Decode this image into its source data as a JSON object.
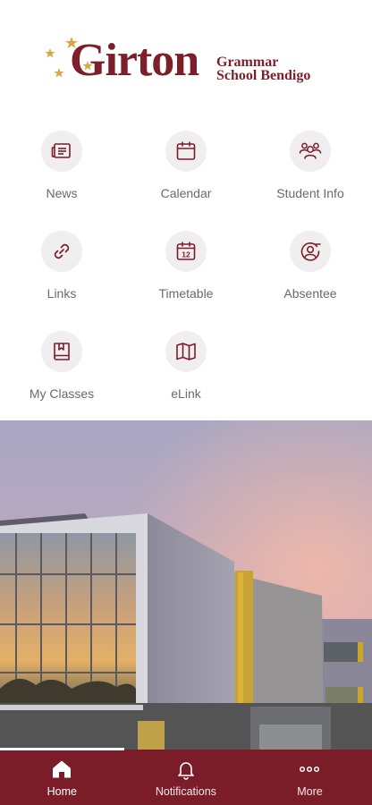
{
  "logo": {
    "name": "Girton",
    "subtitle_line1": "Grammar",
    "subtitle_line2": "School Bendigo"
  },
  "tiles": [
    {
      "label": "News",
      "icon": "newspaper-icon"
    },
    {
      "label": "Calendar",
      "icon": "calendar-icon"
    },
    {
      "label": "Student Info",
      "icon": "users-icon"
    },
    {
      "label": "Links",
      "icon": "link-icon"
    },
    {
      "label": "Timetable",
      "icon": "timetable-calendar-icon",
      "icon_text": "12"
    },
    {
      "label": "Absentee",
      "icon": "user-minus-icon"
    },
    {
      "label": "My Classes",
      "icon": "bookmark-book-icon"
    },
    {
      "label": "eLink",
      "icon": "map-icon"
    }
  ],
  "nav": {
    "items": [
      {
        "label": "Home",
        "icon": "home-icon",
        "active": true
      },
      {
        "label": "Notifications",
        "icon": "bell-icon",
        "active": false
      },
      {
        "label": "More",
        "icon": "more-dots-icon",
        "active": false
      }
    ]
  },
  "colors": {
    "brand": "#7b1d29",
    "star": "#d4a843",
    "tile_bg": "#f0eeee",
    "label": "#6a6a6a"
  }
}
